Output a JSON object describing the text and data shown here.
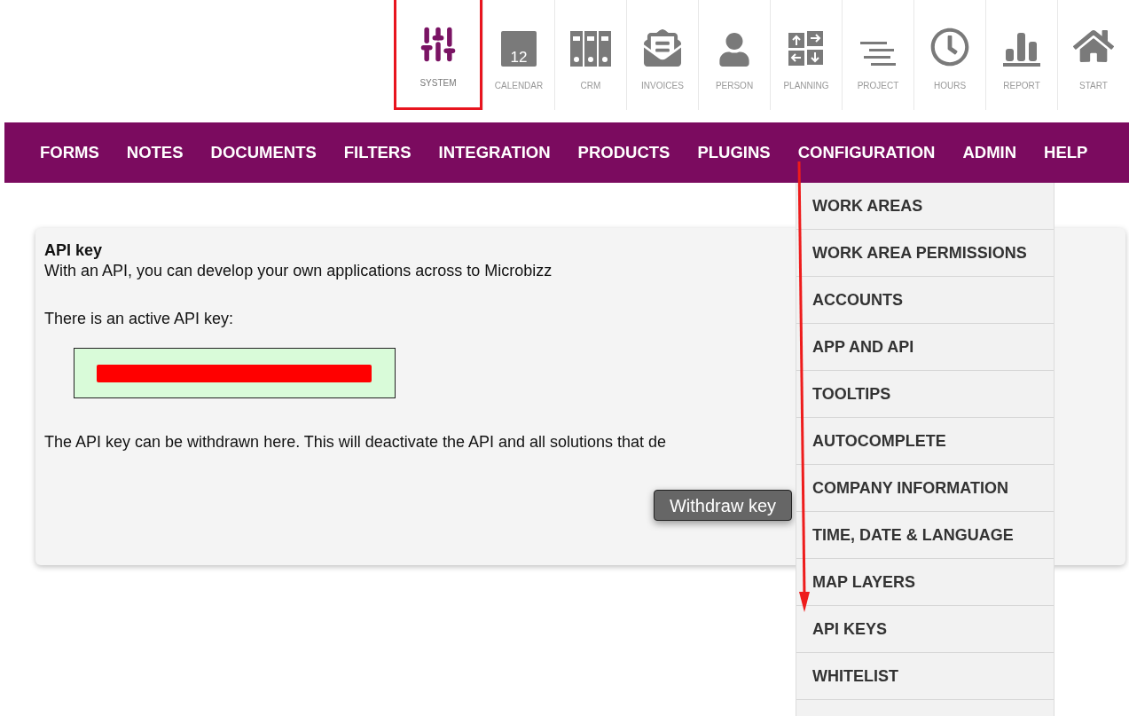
{
  "modules": [
    {
      "kind": "system",
      "label": "SYSTEM",
      "selected": true
    },
    {
      "kind": "calendar",
      "label": "CALENDAR",
      "selected": false,
      "icon_text": "12"
    },
    {
      "kind": "crm",
      "label": "CRM",
      "selected": false
    },
    {
      "kind": "invoices",
      "label": "INVOICES",
      "selected": false
    },
    {
      "kind": "person",
      "label": "PERSON",
      "selected": false
    },
    {
      "kind": "planning",
      "label": "PLANNING",
      "selected": false
    },
    {
      "kind": "project",
      "label": "PROJECT",
      "selected": false
    },
    {
      "kind": "hours",
      "label": "HOURS",
      "selected": false
    },
    {
      "kind": "report",
      "label": "REPORT",
      "selected": false
    },
    {
      "kind": "start",
      "label": "START",
      "selected": false
    }
  ],
  "menu": [
    {
      "label": "FORMS",
      "expanded": false
    },
    {
      "label": "NOTES",
      "expanded": false
    },
    {
      "label": "DOCUMENTS",
      "expanded": false
    },
    {
      "label": "FILTERS",
      "expanded": false
    },
    {
      "label": "INTEGRATION",
      "expanded": false
    },
    {
      "label": "PRODUCTS",
      "expanded": false
    },
    {
      "label": "PLUGINS",
      "expanded": false
    },
    {
      "label": "CONFIGURATION",
      "expanded": true,
      "items": [
        "WORK AREAS",
        "WORK AREA PERMISSIONS",
        "ACCOUNTS",
        "APP AND API",
        "TOOLTIPS",
        "AUTOCOMPLETE",
        "COMPANY INFORMATION",
        "TIME, DATE & LANGUAGE",
        "MAP LAYERS",
        "API KEYS",
        "WHITELIST"
      ]
    },
    {
      "label": "ADMIN",
      "expanded": false
    },
    {
      "label": "HELP",
      "expanded": false
    }
  ],
  "panel": {
    "title": "API key",
    "intro": "With an API, you can develop your own applications across to Microbizz",
    "status": "There is an active API key:",
    "key_redacted": true,
    "withdraw_text": "The API key can be withdrawn here. This will deactivate the API and all solutions that de",
    "button": "Withdraw key"
  }
}
